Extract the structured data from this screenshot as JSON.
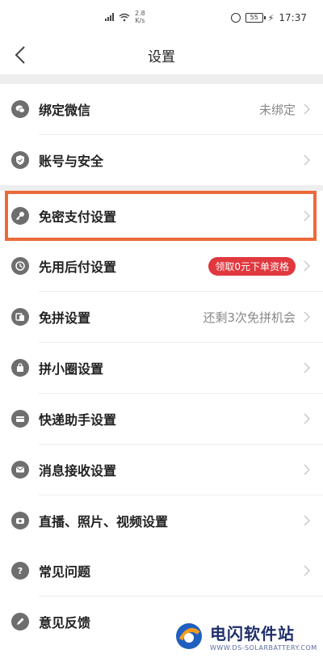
{
  "status_bar": {
    "speed_value": "2.8",
    "speed_unit": "K/s",
    "battery": "55",
    "time": "17:37"
  },
  "header": {
    "title": "设置"
  },
  "groups": [
    {
      "items": [
        {
          "label": "绑定微信",
          "value": "未绑定",
          "icon": "wechat-icon"
        },
        {
          "label": "账号与安全",
          "value": "",
          "icon": "shield-icon"
        }
      ]
    },
    {
      "items": [
        {
          "label": "免密支付设置",
          "value": "",
          "icon": "key-icon",
          "highlighted": true
        },
        {
          "label": "先用后付设置",
          "badge": "领取0元下单资格",
          "icon": "pay-later-icon"
        },
        {
          "label": "免拼设置",
          "value": "还剩3次免拼机会",
          "icon": "group-buy-icon"
        },
        {
          "label": "拼小圈设置",
          "value": "",
          "icon": "bag-icon"
        },
        {
          "label": "快递助手设置",
          "value": "",
          "icon": "package-icon"
        },
        {
          "label": "消息接收设置",
          "value": "",
          "icon": "mail-icon"
        },
        {
          "label": "直播、照片、视频设置",
          "value": "",
          "icon": "video-icon"
        }
      ]
    },
    {
      "items": [
        {
          "label": "常见问题",
          "value": "",
          "icon": "question-icon"
        },
        {
          "label": "意见反馈",
          "value": "",
          "icon": "edit-icon"
        }
      ]
    }
  ],
  "highlight_color": "#ec6a3a",
  "badge_color": "#e0383e",
  "watermark": {
    "title": "电闪软件站",
    "url": "WWW.DS-SOLARBATTERY.COM"
  }
}
